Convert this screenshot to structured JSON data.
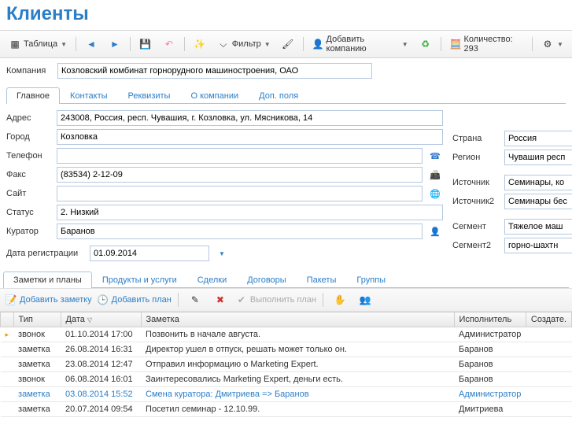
{
  "title": "Клиенты",
  "toolbar": {
    "table": "Таблица",
    "filter": "Фильтр",
    "addCompany": "Добавить компанию",
    "count": "Количество: 293"
  },
  "company": {
    "label": "Компания",
    "value": "Козловский комбинат горнорудного машиностроения, ОАО"
  },
  "mainTabs": [
    {
      "label": "Главное",
      "active": true
    },
    {
      "label": "Контакты"
    },
    {
      "label": "Реквизиты"
    },
    {
      "label": "О компании"
    },
    {
      "label": "Доп. поля"
    }
  ],
  "fields": {
    "address": {
      "label": "Адрес",
      "value": "243008, Россия, респ. Чувашия, г. Козловка, ул. Мясникова, 14"
    },
    "city": {
      "label": "Город",
      "value": "Козловка"
    },
    "phone": {
      "label": "Телефон",
      "value": ""
    },
    "fax": {
      "label": "Факс",
      "value": "(83534) 2-12-09"
    },
    "site": {
      "label": "Сайт",
      "value": ""
    },
    "status": {
      "label": "Статус",
      "value": "2. Низкий"
    },
    "curator": {
      "label": "Куратор",
      "value": "Баранов"
    },
    "regDate": {
      "label": "Дата регистрации",
      "value": "01.09.2014"
    }
  },
  "rightFields": {
    "country": {
      "label": "Страна",
      "value": "Россия"
    },
    "region": {
      "label": "Регион",
      "value": "Чувашия респ"
    },
    "source": {
      "label": "Источник",
      "value": "Семинары, ко"
    },
    "source2": {
      "label": "Источник2",
      "value": "Семинары бес"
    },
    "segment": {
      "label": "Сегмент",
      "value": "Тяжелое маш"
    },
    "segment2": {
      "label": "Сегмент2",
      "value": "горно-шахтн"
    }
  },
  "subTabs": [
    {
      "label": "Заметки и планы",
      "active": true
    },
    {
      "label": "Продукты и услуги"
    },
    {
      "label": "Сделки"
    },
    {
      "label": "Договоры"
    },
    {
      "label": "Пакеты"
    },
    {
      "label": "Группы"
    }
  ],
  "subToolbar": {
    "addNote": "Добавить заметку",
    "addPlan": "Добавить план",
    "doPlan": "Выполнить план"
  },
  "grid": {
    "headers": {
      "type": "Тип",
      "date": "Дата",
      "note": "Заметка",
      "executor": "Исполнитель",
      "creator": "Создате."
    },
    "rows": [
      {
        "type": "звонок",
        "date": "01.10.2014 17:00",
        "note": "Позвонить в начале августа.",
        "executor": "Администратор"
      },
      {
        "type": "заметка",
        "date": "26.08.2014 16:31",
        "note": "Директор ушел в отпуск, решать может только он.",
        "executor": "Баранов"
      },
      {
        "type": "заметка",
        "date": "23.08.2014 12:47",
        "note": "Отправил информацию о Marketing Expert.",
        "executor": "Баранов"
      },
      {
        "type": "звонок",
        "date": "06.08.2014 16:01",
        "note": "Заинтересовались Marketing Expert, деньги есть.",
        "executor": "Баранов"
      },
      {
        "type": "заметка",
        "date": "03.08.2014 15:52",
        "note": "Смена куратора: Дмитриева => Баранов",
        "executor": "Администратор",
        "hl": true
      },
      {
        "type": "заметка",
        "date": "20.07.2014 09:54",
        "note": "Посетил семинар - 12.10.99.",
        "executor": "Дмитриева"
      }
    ]
  }
}
